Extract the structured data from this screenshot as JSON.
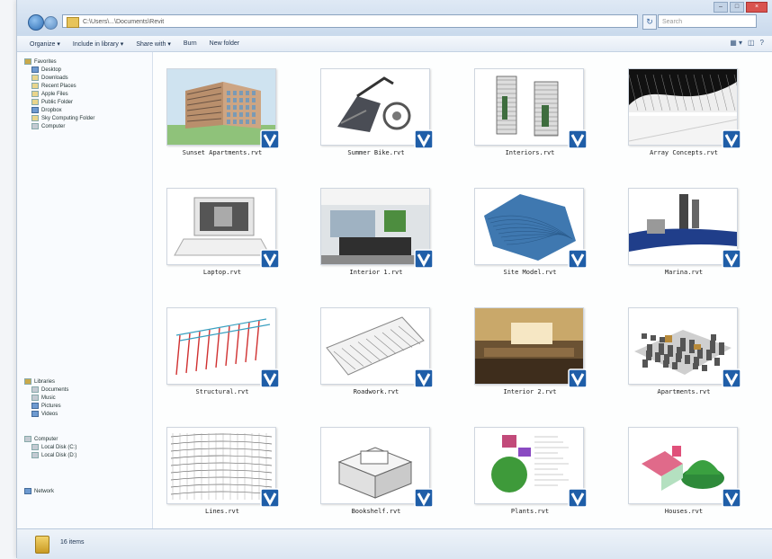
{
  "window": {
    "address_path": "C:\\Users\\...\\Documents\\Revit",
    "search_placeholder": "Search",
    "refresh_glyph": "↻",
    "controls": [
      "–",
      "□",
      "×"
    ]
  },
  "toolbar": {
    "items": [
      "Organize ▾",
      "Include in library ▾",
      "Share with ▾",
      "Burn",
      "New folder"
    ],
    "right_glyphs": [
      "▦ ▾",
      "◫",
      "?"
    ]
  },
  "navpane": {
    "favorites": {
      "header": "Favorites",
      "items": [
        "Desktop",
        "Downloads",
        "Recent Places",
        "Apple Files",
        "Public Folder",
        "Dropbox",
        "Sky Computing Folder",
        "Computer"
      ]
    },
    "libraries": {
      "header": "Libraries",
      "items": [
        "Documents",
        "Music",
        "Pictures",
        "Videos"
      ]
    },
    "computer": {
      "header": "Computer",
      "items": [
        "Local Disk (C:)",
        "Local Disk (D:)"
      ]
    },
    "network": {
      "header": "Network"
    }
  },
  "files": [
    {
      "name": "Sunset Apartments.rvt",
      "art": "building"
    },
    {
      "name": "Summer Bike.rvt",
      "art": "bike"
    },
    {
      "name": "Interiors.rvt",
      "art": "towers"
    },
    {
      "name": "Array Concepts.rvt",
      "art": "array"
    },
    {
      "name": "Laptop.rvt",
      "art": "laptop"
    },
    {
      "name": "Interior 1.rvt",
      "art": "interior"
    },
    {
      "name": "Site Model.rvt",
      "art": "site"
    },
    {
      "name": "Marina.rvt",
      "art": "marina"
    },
    {
      "name": "Structural.rvt",
      "art": "structure"
    },
    {
      "name": "Roadwork.rvt",
      "art": "road"
    },
    {
      "name": "Interior 2.rvt",
      "art": "interior2"
    },
    {
      "name": "Apartments.rvt",
      "art": "city"
    },
    {
      "name": "Lines.rvt",
      "art": "lines"
    },
    {
      "name": "Bookshelf.rvt",
      "art": "box"
    },
    {
      "name": "Plants.rvt",
      "art": "plants"
    },
    {
      "name": "Houses.rvt",
      "art": "houses"
    }
  ],
  "status": {
    "text": "16 items"
  }
}
